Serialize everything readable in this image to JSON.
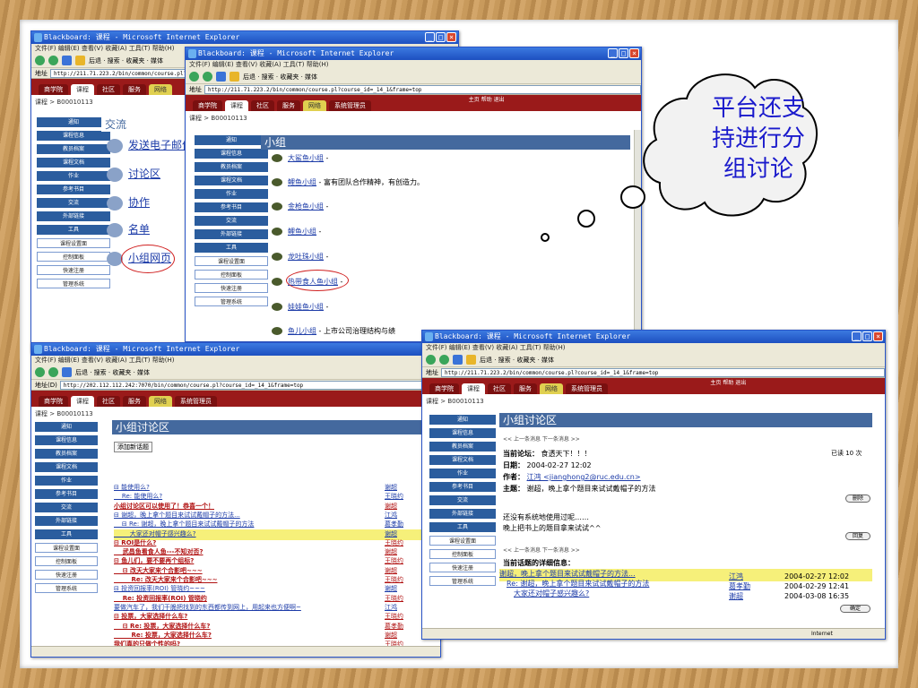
{
  "menubar": "文件(F)  编辑(E)  查看(V)  收藏(A)  工具(T)  帮助(H)",
  "toolbar_text": "后退 · 搜索 · 收藏夹 · 媒体",
  "nav_tabs": [
    "商学院",
    "课程",
    "社区",
    "服务",
    "网络",
    "系统管理员"
  ],
  "nav_mini": "主页  帮助  退出",
  "status_internet": "Internet",
  "w1": {
    "title": "Blackboard: 课程 - Microsoft Internet Explorer",
    "crumb": "课程 > B00010113",
    "side": [
      "通知",
      "课程信息",
      "教员档案",
      "课程文档",
      "作业",
      "参考书目",
      "交流",
      "外部链接",
      "工具",
      "课程设置面",
      "控制面板",
      "快速注册",
      "管理系统"
    ],
    "heading": "交流",
    "items": [
      "发送电子邮件",
      "讨论区",
      "协作",
      "名单",
      "小组网页"
    ]
  },
  "w2": {
    "title": "Blackboard: 课程 - Microsoft Internet Explorer",
    "address": "http://211.71.223.2/bin/common/course.pl?course_id=_14_1&frame=top",
    "crumb": "课程 > B00010113",
    "side": [
      "通知",
      "课程信息",
      "教员档案",
      "课程文档",
      "作业",
      "参考书目",
      "交流",
      "外部链接",
      "工具",
      "课程设置面",
      "控制面板",
      "快速注册",
      "管理系统"
    ],
    "heading": "小组",
    "groups": [
      {
        "name": "大鲨鱼小组",
        "desc": "-"
      },
      {
        "name": "鲤鱼小组",
        "desc": "- 富有团队合作精神，有创造力。"
      },
      {
        "name": "金枪鱼小组",
        "desc": "-"
      },
      {
        "name": "鲤鱼小组",
        "desc": "-"
      },
      {
        "name": "龙吐珠小组",
        "desc": "-"
      },
      {
        "name": "热带食人鱼小组",
        "desc": "-"
      },
      {
        "name": "娃娃鱼小组",
        "desc": "-"
      },
      {
        "name": "鱼儿小组",
        "desc": "- 上市公司治理结构与绩"
      }
    ]
  },
  "w3": {
    "title": "Blackboard: 课程 - Microsoft Internet Explorer",
    "address": "http://202.112.112.242:7070/bin/common/course.pl?course_id=_14_1&frame=top",
    "crumb": "课程 > B00010113",
    "side": [
      "通知",
      "课程信息",
      "教员档案",
      "课程文档",
      "作业",
      "参考书目",
      "交流",
      "外部链接",
      "工具",
      "课程设置面",
      "控制面板",
      "快速注册",
      "管理系统"
    ],
    "heading": "小组讨论区",
    "add_topic": "添加新话题",
    "posts": [
      {
        "t": "⊟ 能使用么?",
        "a": "谢超",
        "style": "n"
      },
      {
        "t": "    Re: 能使用么?",
        "a": "王晓约",
        "style": "n"
      },
      {
        "t": "小组讨论区可以使用了！恭喜一个！",
        "a": "谢超",
        "style": "r"
      },
      {
        "t": "⊟ 谢超，晚上拿个题目来试试戴帽子的方法...",
        "a": "江鸿",
        "style": "n"
      },
      {
        "t": "    ⊟ Re: 谢超，晚上拿个题目来试试戴帽子的方法",
        "a": "葛孝勤",
        "style": "n"
      },
      {
        "t": "        大家还对帽子感兴趣么?",
        "a": "谢超",
        "style": "y"
      },
      {
        "t": "⊟ ROI是什么?",
        "a": "王晓约",
        "style": "r"
      },
      {
        "t": "    武昌鱼看食人鱼---不知对否?",
        "a": "谢超",
        "style": "r"
      },
      {
        "t": "⊟ 鱼儿们，要不要再个组标?",
        "a": "王晓约",
        "style": "r"
      },
      {
        "t": "    ⊟ 改天大家来个合影吧~~~",
        "a": "谢超",
        "style": "r"
      },
      {
        "t": "        Re: 改天大家来个合影吧~~~",
        "a": "王晓约",
        "style": "r"
      },
      {
        "t": "⊟ 投资回报率(ROI) 管晓约~~~",
        "a": "谢超",
        "style": "n"
      },
      {
        "t": "    Re: 投资回报率(ROI) 管晓约",
        "a": "王晓约",
        "style": "r"
      },
      {
        "t": "要做汽车了，我们干脆把找到的东西都传到网上，用起来也方便啊~",
        "a": "江鸿",
        "style": "n"
      },
      {
        "t": "⊟ 投票，大家选择什么车?",
        "a": "王晓约",
        "style": "r"
      },
      {
        "t": "    ⊟ Re: 投票，大家选择什么车?",
        "a": "葛孝勤",
        "style": "r"
      },
      {
        "t": "        Re: 投票，大家选择什么车?",
        "a": "谢超",
        "style": "r"
      },
      {
        "t": "我们真的只做个性的吗?",
        "a": "王晓约",
        "style": "r"
      }
    ]
  },
  "w4": {
    "title": "Blackboard: 课程 - Microsoft Internet Explorer",
    "address": "http://211.71.223.2/bin/common/course.pl?course_id=_14_1&frame=top",
    "crumb": "课程 > B00010113",
    "side": [
      "通知",
      "课程信息",
      "教员档案",
      "课程文档",
      "作业",
      "参考书目",
      "交流",
      "外部链接",
      "工具",
      "课程设置面",
      "控制面板",
      "快速注册",
      "管理系统"
    ],
    "heading": "小组讨论区",
    "pager": "<< 上一条消息    下一条消息 >>",
    "forum_label": "当前论坛：",
    "forum": "食透天下！！！",
    "read": "已读  10 次",
    "date_label": "日期：",
    "date": "2004-02-27 12:02",
    "author_label": "作者：",
    "author": "江鸿 <jianghong2@ruc.edu.cn>",
    "subject_label": "主题：",
    "subject": "谢超，晚上拿个题目来试试戴帽子的方法",
    "btn_delete": "删除",
    "body1": "还没有系统地使用过呢……",
    "body2": "晚上把书上的题目拿来试试^^",
    "btn_reply": "回复",
    "detail_title": "当前话题的详细信息：",
    "thread": [
      {
        "t": "谢超，晚上拿个题目来试试戴帽子的方法...",
        "a": "江鸿",
        "d": "2004-02-27 12:02",
        "hl": true
      },
      {
        "t": "Re: 谢超，晚上拿个题目来试试戴帽子的方法",
        "a": "葛孝勤",
        "d": "2004-02-29 12:41",
        "hl": false
      },
      {
        "t": "大家还对帽子感兴趣么?",
        "a": "谢超",
        "d": "2004-03-08 16:35",
        "hl": false
      }
    ],
    "btn_ok": "确定"
  },
  "bubble": "平台还支持进行分组讨论"
}
